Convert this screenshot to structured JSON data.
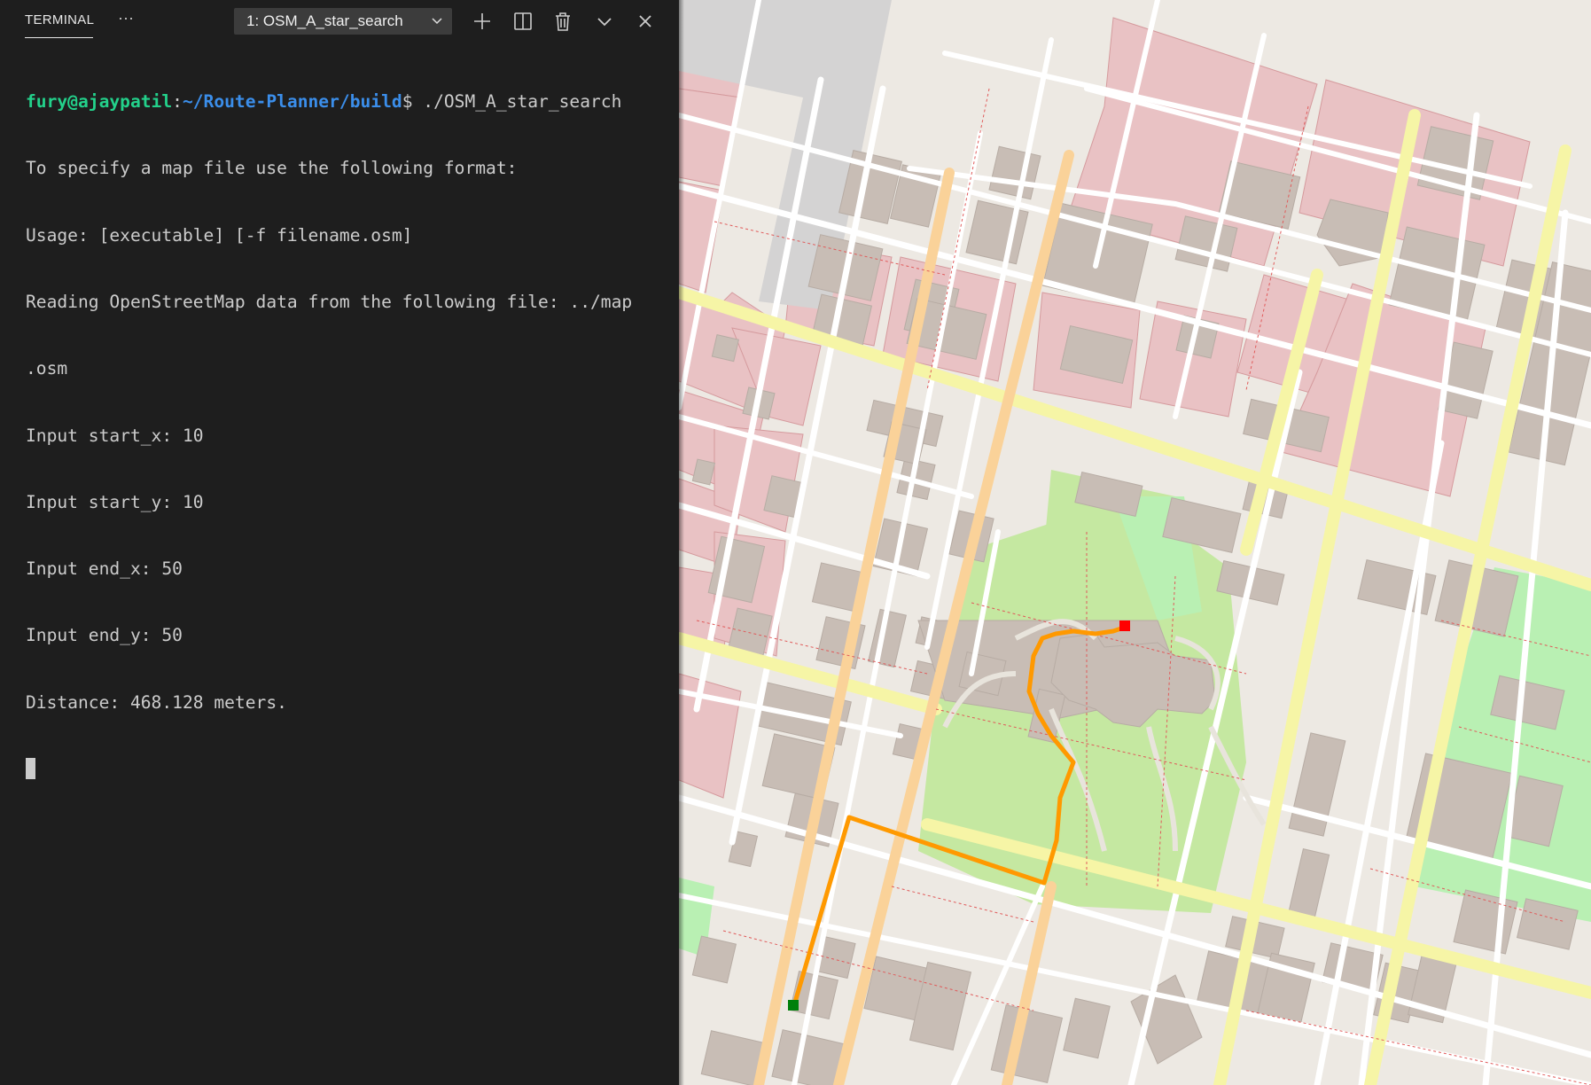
{
  "terminal": {
    "tab_label": "TERMINAL",
    "more_label": "···",
    "session_select": "1: OSM_A_star_search",
    "icons": [
      "plus-icon",
      "split-icon",
      "trash-icon",
      "chevron-down-icon",
      "close-icon"
    ],
    "prompt_user": "fury@ajaypatil",
    "prompt_colon": ":",
    "prompt_path": "~/Route-Planner/build",
    "prompt_symbol": "$ ",
    "command": "./OSM_A_star_search",
    "output": [
      "To specify a map file use the following format:",
      "Usage: [executable] [-f filename.osm]",
      "Reading OpenStreetMap data from the following file: ../map",
      ".osm",
      "Input start_x: 10",
      "Input start_y: 10",
      "Input end_x: 50",
      "Input end_y: 50",
      "Distance: 468.128 meters."
    ]
  },
  "map": {
    "colors": {
      "background": "#ede9e3",
      "residential_red": "#e9c2c4",
      "building": "#c8bdb5",
      "park": "#c5e8a1",
      "grass": "#b9f0b3",
      "main_road": "#fad299",
      "secondary_road": "#f6f5a6",
      "route": "#ff9900",
      "start_marker": "#00800c",
      "end_marker": "#ff0000"
    }
  }
}
